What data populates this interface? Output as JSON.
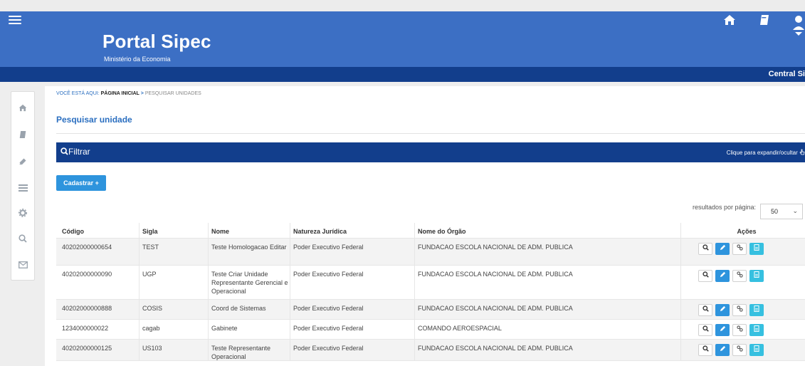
{
  "header": {
    "title": "Portal Sipec",
    "subtitle": "Ministério da Economia",
    "icons": [
      "menu-icon",
      "home-icon",
      "book-icon",
      "user-icon"
    ]
  },
  "bluebar": {
    "text": "Central Si"
  },
  "sidebar": {
    "icons": [
      "home-icon",
      "book-icon",
      "attach-icon",
      "list-icon",
      "gear-icon",
      "search-icon",
      "mail-icon"
    ]
  },
  "breadcrumb": {
    "prefix": "VOCÊ ESTÁ AQUI:",
    "home": "PÁGINA INICIAL",
    "sep": ">",
    "current": "PESQUISAR UNIDADES"
  },
  "page": {
    "title": "Pesquisar unidade"
  },
  "filter": {
    "label": "Filtrar",
    "hint": "Clique para expandir/ocultar"
  },
  "toolbar": {
    "cadastrar_label": "Cadastrar +"
  },
  "pagination": {
    "label": "resultados por página:",
    "value": "50"
  },
  "table": {
    "headers": [
      "Código",
      "Sigla",
      "Nome",
      "Natureza Jurídica",
      "Nome do Órgão",
      "Ações"
    ],
    "rows": [
      {
        "codigo": "40202000000654",
        "sigla": "TEST",
        "nome": "Teste Homologacao Editar",
        "natureza": "Poder Executivo Federal",
        "orgao": "FUNDACAO ESCOLA NACIONAL DE ADM. PUBLICA"
      },
      {
        "codigo": "40202000000090",
        "sigla": "UGP",
        "nome": "Teste Criar Unidade Representante Gerencial e Operacional",
        "natureza": "Poder Executivo Federal",
        "orgao": "FUNDACAO ESCOLA NACIONAL DE ADM. PUBLICA"
      },
      {
        "codigo": "40202000000888",
        "sigla": "COSIS",
        "nome": "Coord de Sistemas",
        "natureza": "Poder Executivo Federal",
        "orgao": "FUNDACAO ESCOLA NACIONAL DE ADM. PUBLICA"
      },
      {
        "codigo": "1234000000022",
        "sigla": "cagab",
        "nome": "Gabinete",
        "natureza": "Poder Executivo Federal",
        "orgao": "COMANDO AEROESPACIAL"
      },
      {
        "codigo": "40202000000125",
        "sigla": "US103",
        "nome": "Teste Representante Operacional",
        "natureza": "Poder Executivo Federal",
        "orgao": "FUNDACAO ESCOLA NACIONAL DE ADM. PUBLICA"
      }
    ]
  },
  "colors": {
    "header_blue": "#3c6fc4",
    "navy": "#123e8c",
    "accent_blue": "#2e94dd",
    "teal": "#36c0e0",
    "link_blue": "#2b6fc0"
  }
}
